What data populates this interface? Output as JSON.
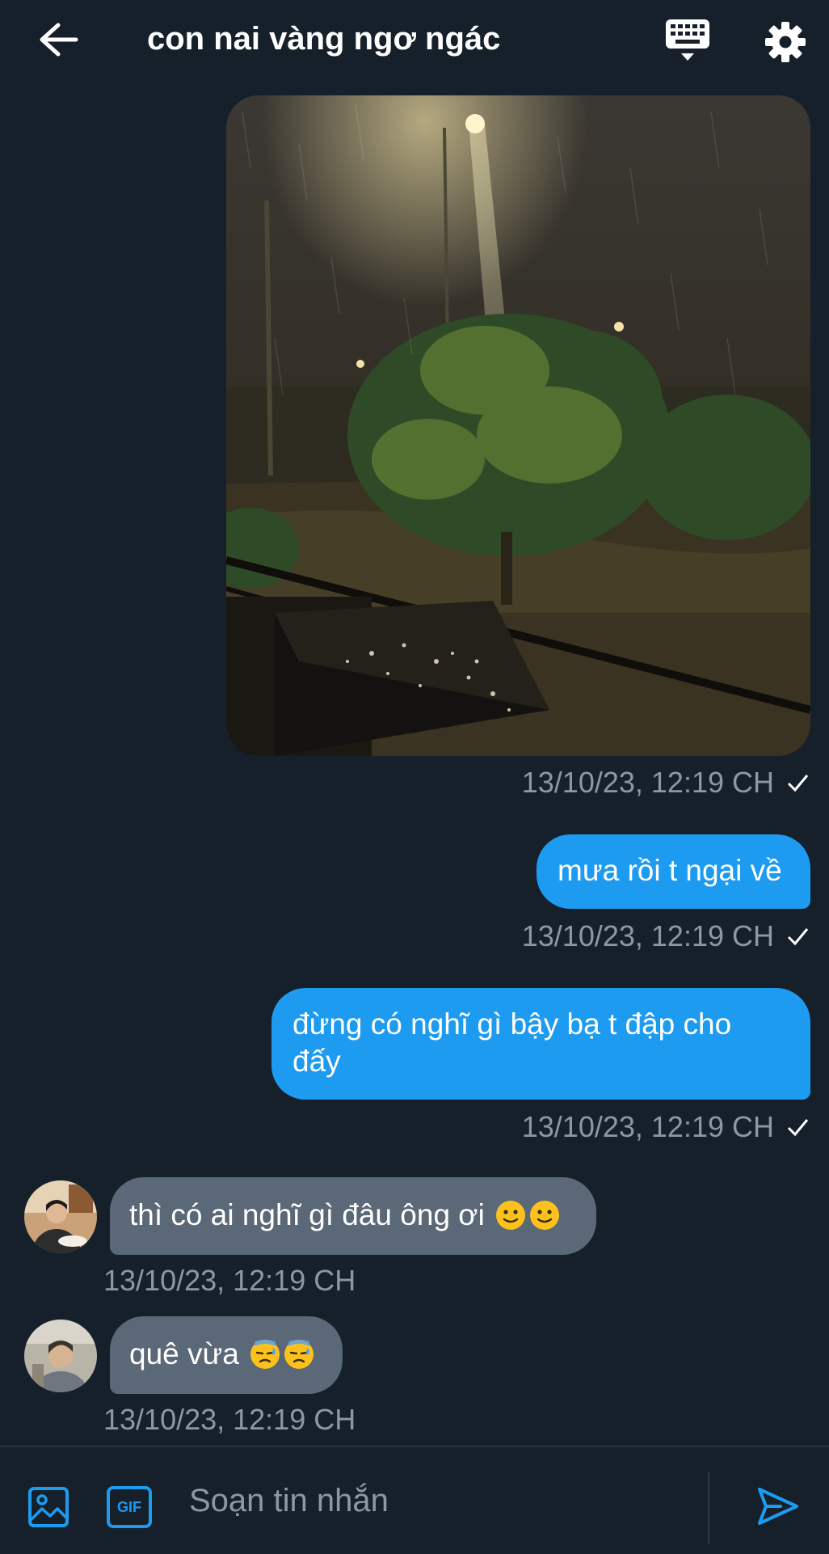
{
  "header": {
    "title": "con nai vàng ngơ ngác",
    "back_icon": "arrow-left-icon",
    "keyboard_icon": "keyboard-icon",
    "settings_icon": "gear-icon"
  },
  "messages": [
    {
      "type": "image",
      "direction": "outgoing",
      "image_icon": "night-rain-photo",
      "timestamp": "13/10/23, 12:19 CH",
      "status_icon": "check-icon"
    },
    {
      "type": "text",
      "direction": "outgoing",
      "text": "mưa rồi t ngại về",
      "timestamp": "13/10/23, 12:19 CH",
      "status_icon": "check-icon"
    },
    {
      "type": "text",
      "direction": "outgoing",
      "text_line1": "đừng có nghĩ gì bậy bạ t đập cho",
      "text_line2": "đấy",
      "timestamp": "13/10/23, 12:19 CH",
      "status_icon": "check-icon"
    },
    {
      "type": "text",
      "direction": "incoming",
      "text": "thì có ai nghĩ gì đâu ông ơi",
      "emoji": [
        "slightly-smiling-face",
        "slightly-smiling-face"
      ],
      "timestamp": "13/10/23, 12:19 CH"
    },
    {
      "type": "text",
      "direction": "incoming",
      "text": "quê vừa",
      "emoji": [
        "downcast-sweat-face",
        "downcast-sweat-face"
      ],
      "timestamp": "13/10/23, 12:19 CH"
    }
  ],
  "composer": {
    "placeholder": "Soạn tin nhắn",
    "image_icon": "image-icon",
    "gif_label": "GIF",
    "send_icon": "send-icon"
  },
  "colors": {
    "background": "#15202b",
    "outgoing_bubble": "#1d9bf0",
    "incoming_bubble": "#5b6877",
    "timestamp": "#8b98a5",
    "accent": "#1d9bf0"
  }
}
